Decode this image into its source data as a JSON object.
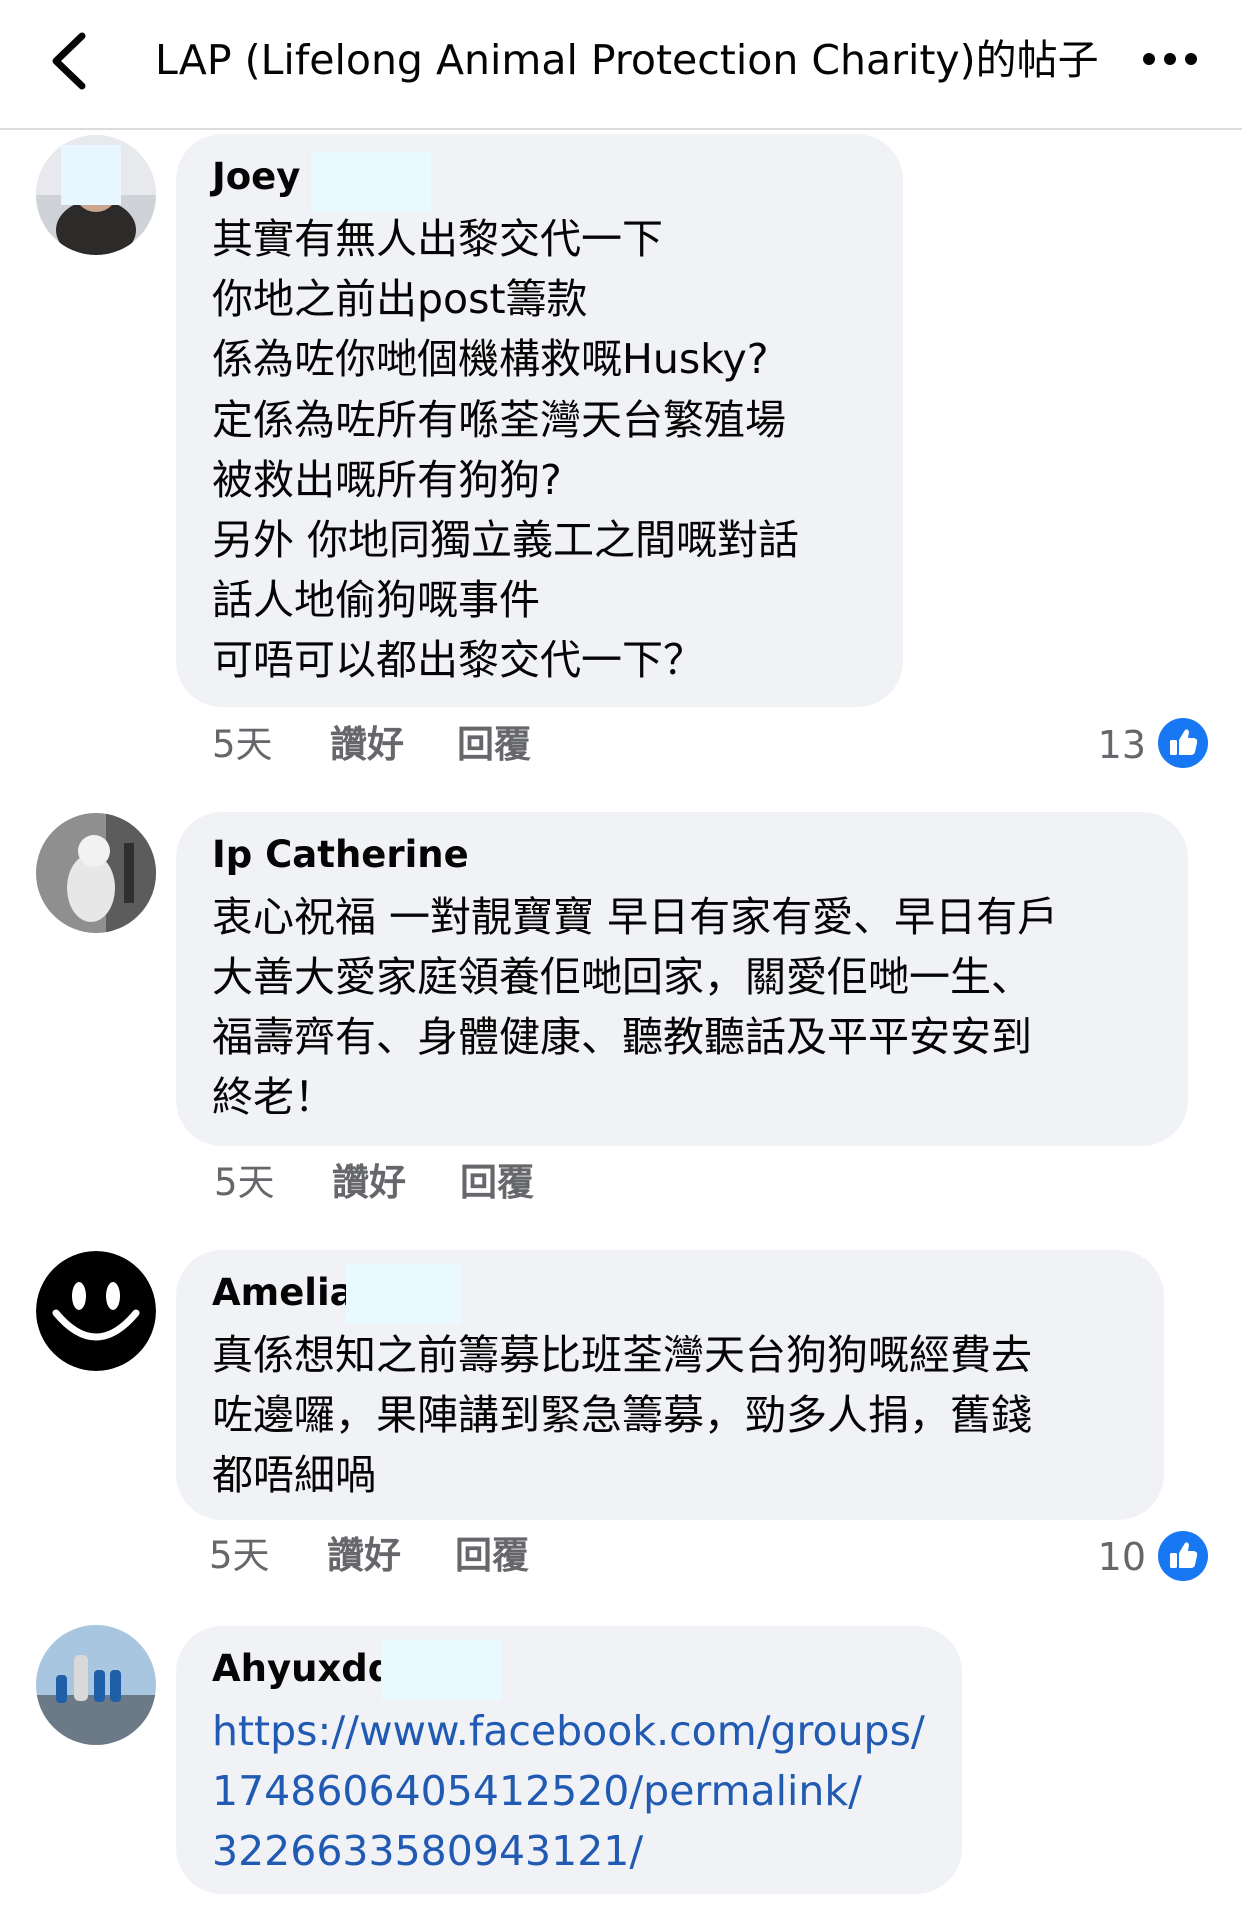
{
  "header": {
    "title": "LAP (Lifelong Animal Protection Charity)的帖子"
  },
  "colors": {
    "link": "#215ab2",
    "like": "#1877f2",
    "bubble": "#f0f2f5",
    "meta": "#65676b"
  },
  "comments": [
    {
      "author": "Joey",
      "lines": [
        "其實有無人出黎交代一下",
        "你地之前出post籌款",
        "係為咗你哋個機構救嘅Husky?",
        "定係為咗所有喺荃灣天台繁殖場",
        "被救出嘅所有狗狗?",
        "另外 你地同獨立義工之間嘅對話",
        "話人地偷狗嘅事件",
        "可唔可以都出黎交代一下？"
      ],
      "time": "5天",
      "like_label": "讚好",
      "reply_label": "回覆",
      "reactions": "13"
    },
    {
      "author": "Ip Catherine",
      "lines": [
        "衷心祝福 一對靚寶寶 早日有家有愛、早日有戶",
        "大善大愛家庭領養佢哋回家，關愛佢哋一生、",
        "福壽齊有、身體健康、聽教聽話及平平安安到",
        "終老！"
      ],
      "time": "5天",
      "like_label": "讚好",
      "reply_label": "回覆"
    },
    {
      "author": "Amelia",
      "lines": [
        "真係想知之前籌募比班荃灣天台狗狗嘅經費去",
        "咗邊囉，果陣講到緊急籌募，勁多人捐，舊錢",
        "都唔細喎"
      ],
      "time": "5天",
      "like_label": "讚好",
      "reply_label": "回覆",
      "reactions": "10"
    },
    {
      "author": "Ahyuxdd",
      "lines": [
        "https://www.facebook.com/groups/",
        "1748606405412520/permalink/",
        "3226633580943121/"
      ]
    }
  ]
}
